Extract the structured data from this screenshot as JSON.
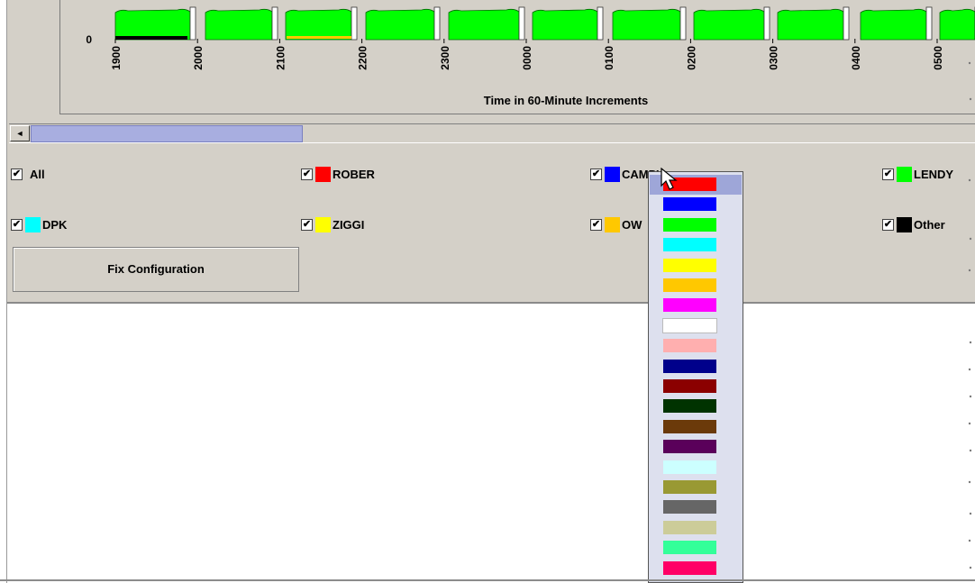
{
  "chart": {
    "y_zero_label": "0",
    "x_ticks": [
      "1900",
      "2000",
      "2100",
      "2200",
      "2300",
      "0000",
      "0100",
      "0200",
      "0300",
      "0400",
      "0500"
    ],
    "x_axis_label": "Time in 60-Minute Increments"
  },
  "legend": [
    {
      "label": "All",
      "color": null,
      "checked": true
    },
    {
      "label": "ROBER",
      "color": "#ff0000",
      "checked": true
    },
    {
      "label": "CAMPY",
      "color": "#0000ff",
      "checked": true
    },
    {
      "label": "LENDY",
      "color": "#00ff00",
      "checked": true
    },
    {
      "label": "DPK",
      "color": "#00ffff",
      "checked": true
    },
    {
      "label": "ZIGGI",
      "color": "#ffff00",
      "checked": true
    },
    {
      "label": "OW",
      "color": "#ffc800",
      "checked": true
    },
    {
      "label": "Other",
      "color": "#000000",
      "checked": true
    }
  ],
  "check_glyph": "✔",
  "scroll_left_glyph": "◄",
  "fix_button_label": "Fix Configuration",
  "color_menu": [
    {
      "name": "red",
      "color": "#ff0000"
    },
    {
      "name": "blue",
      "color": "#0000ff"
    },
    {
      "name": "green",
      "color": "#00ff00"
    },
    {
      "name": "cyan",
      "color": "#00ffff"
    },
    {
      "name": "yellow",
      "color": "#ffff00"
    },
    {
      "name": "orange",
      "color": "#ffc800"
    },
    {
      "name": "magenta",
      "color": "#ff00ff"
    },
    {
      "name": "white",
      "color": "#ffffff"
    },
    {
      "name": "pink",
      "color": "#ffafaf"
    },
    {
      "name": "navy",
      "color": "#00008b"
    },
    {
      "name": "dark-red",
      "color": "#8b0000"
    },
    {
      "name": "dark-green",
      "color": "#003300"
    },
    {
      "name": "brown",
      "color": "#6b3a0a"
    },
    {
      "name": "purple",
      "color": "#5a005a"
    },
    {
      "name": "light-cyan",
      "color": "#ccffff"
    },
    {
      "name": "olive",
      "color": "#999933"
    },
    {
      "name": "gray",
      "color": "#666666"
    },
    {
      "name": "tan",
      "color": "#cccc99"
    },
    {
      "name": "sea-green",
      "color": "#33ff99"
    },
    {
      "name": "crimson",
      "color": "#ff0066"
    }
  ],
  "colors": {
    "panel_bg": "#d4d0c8",
    "chart_fill": "#00ff00",
    "selection": "#9ea6d8"
  }
}
